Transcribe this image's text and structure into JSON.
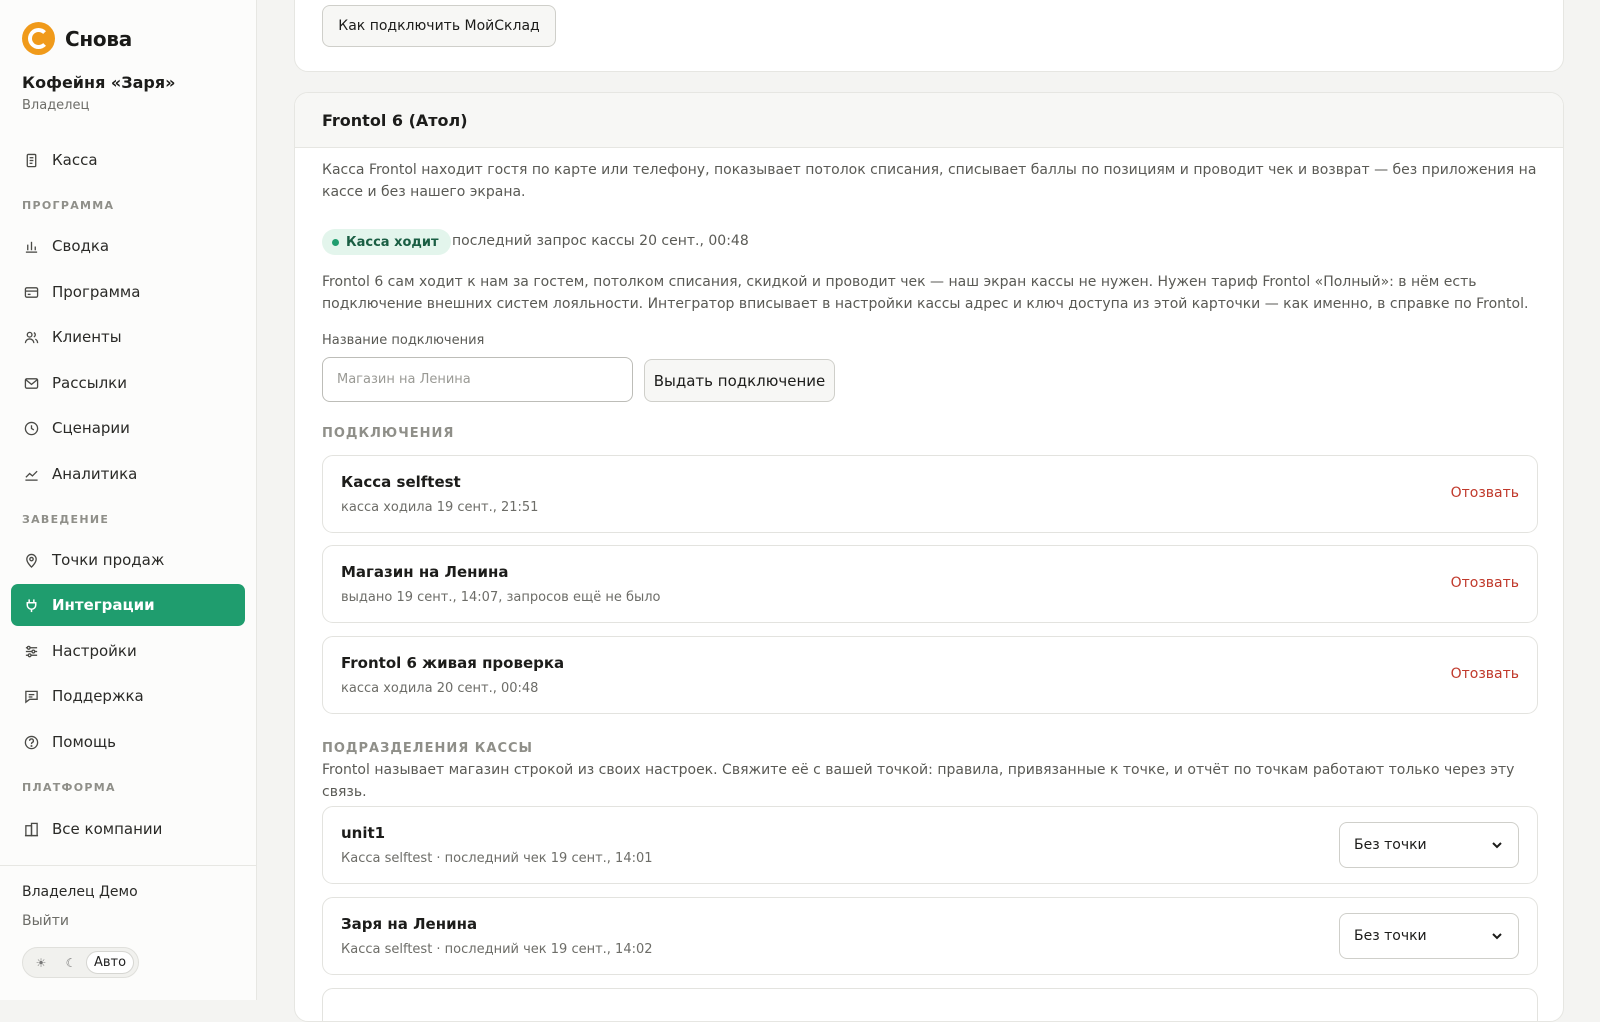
{
  "brand": {
    "name": "Снова",
    "accent": "#f09a1a"
  },
  "org": {
    "name": "Кофейня «Заря»",
    "role": "Владелец"
  },
  "nav": {
    "top": [
      {
        "label": "Касса",
        "icon": "receipt-icon"
      }
    ],
    "sections": [
      {
        "title": "ПРОГРАММА",
        "items": [
          {
            "label": "Сводка",
            "icon": "bar-chart-icon"
          },
          {
            "label": "Программа",
            "icon": "card-icon"
          },
          {
            "label": "Клиенты",
            "icon": "users-icon"
          },
          {
            "label": "Рассылки",
            "icon": "mail-icon"
          },
          {
            "label": "Сценарии",
            "icon": "clock-icon"
          },
          {
            "label": "Аналитика",
            "icon": "trend-icon"
          }
        ]
      },
      {
        "title": "ЗАВЕДЕНИЕ",
        "items": [
          {
            "label": "Точки продаж",
            "icon": "map-pin-icon"
          },
          {
            "label": "Интеграции",
            "icon": "plug-icon",
            "active": true
          },
          {
            "label": "Настройки",
            "icon": "sliders-icon"
          },
          {
            "label": "Поддержка",
            "icon": "chat-icon"
          },
          {
            "label": "Помощь",
            "icon": "help-circle-icon"
          }
        ]
      },
      {
        "title": "ПЛАТФОРМА",
        "items": [
          {
            "label": "Все компании",
            "icon": "buildings-icon"
          }
        ]
      }
    ],
    "active_color": "#1f9d6e"
  },
  "user": {
    "name": "Владелец Демо",
    "logout": "Выйти"
  },
  "theme": {
    "light": "☀",
    "dark": "☾",
    "auto": "Авто",
    "selected": "Авто"
  },
  "top_card": {
    "button": "Как подключить МойСклад"
  },
  "frontol": {
    "title": "Frontol 6 (Атол)",
    "description": "Касса Frontol находит гостя по карте или телефону, показывает потолок списания, списывает баллы по позициям и проводит чек и возврат — без приложения на кассе и без нашего экрана.",
    "status": {
      "label": "Касса ходит",
      "meta": "последний запрос кассы 20 сент., 00:48",
      "color": "#1f9d6e"
    },
    "info": "Frontol 6 сам ходит к нам за гостем, потолком списания, скидкой и проводит чек — наш экран кассы не нужен. Нужен тариф Frontol «Полный»: в нём есть подключение внешних систем лояльности. Интегратор вписывает в настройки кассы адрес и ключ доступа из этой карточки — как именно, в справке по Frontol.",
    "connection_name_label": "Название подключения",
    "connection_name_placeholder": "Магазин на Ленина",
    "connection_name_value": "",
    "issue_button": "Выдать подключение",
    "connections_title": "ПОДКЛЮЧЕНИЯ",
    "connections": [
      {
        "name": "Касса selftest",
        "sub": "касса ходила 19 сент., 21:51",
        "action": "Отозвать"
      },
      {
        "name": "Магазин на Ленина",
        "sub": "выдано 19 сент., 14:07, запросов ещё не было",
        "action": "Отозвать"
      },
      {
        "name": "Frontol 6 живая проверка",
        "sub": "касса ходила 20 сент., 00:48",
        "action": "Отозвать"
      }
    ],
    "units_title": "ПОДРАЗДЕЛЕНИЯ КАССЫ",
    "units_description": "Frontol называет магазин строкой из своих настроек. Свяжите её с вашей точкой: правила, привязанные к точке, и отчёт по точкам работают только через эту связь.",
    "units": [
      {
        "name": "unit1",
        "sub": "Касса selftest · последний чек 19 сент., 14:01",
        "point": "Без точки"
      },
      {
        "name": "Заря на Ленина",
        "sub": "Касса selftest · последний чек 19 сент., 14:02",
        "point": "Без точки"
      }
    ],
    "revoke_color": "#c0392b"
  }
}
